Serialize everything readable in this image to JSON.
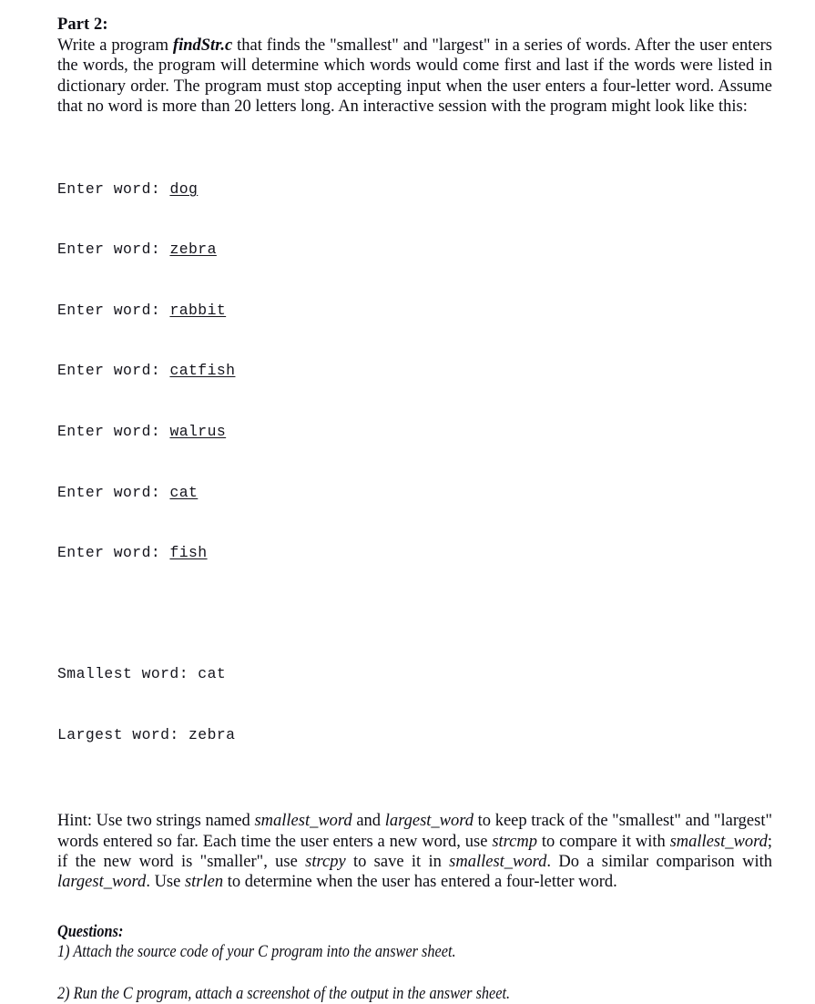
{
  "document": {
    "part_title": "Part 2:",
    "intro": {
      "before_program_name": "Write a program ",
      "program_name": "findStr.c",
      "after_program_name": " that finds the \"smallest\" and \"largest\" in a series of words. After the user enters the words, the program will determine which words would come first and last if the words were listed in dictionary order. The program must stop accepting input when the user enters a four-letter word. Assume that no word is more than 20 letters long. An interactive session with the program might look like this:"
    },
    "console": {
      "prompt": "Enter word: ",
      "entries": [
        "dog",
        "zebra",
        "rabbit",
        "catfish",
        "walrus",
        "cat",
        "fish"
      ],
      "result_lines": [
        {
          "label": "Smallest word: ",
          "value": "cat"
        },
        {
          "label": "Largest word: ",
          "value": "zebra"
        }
      ]
    },
    "hint": {
      "s1": "Hint: Use two strings named ",
      "i1": "smallest_word",
      "s2": " and ",
      "i2": "largest_word",
      "s3": " to keep track of the \"smallest\" and \"largest\" words entered so far. Each time the user enters a new word, use ",
      "i3": "strcmp",
      "s4": " to compare it with ",
      "i4": "smallest_word",
      "s5": "; if the new word is \"smaller\", use ",
      "i5": "strcpy",
      "s6": " to save it in ",
      "i6": "smallest_word",
      "s7": ". Do a similar comparison with ",
      "i7": "largest_word",
      "s8": ". Use ",
      "i8": "strlen",
      "s9": " to determine when the user has entered a four-letter word."
    },
    "questions": {
      "heading": "Questions:",
      "items": [
        "1) Attach the source code of your C program into the answer sheet.",
        "2) Run the C program, attach a screenshot of the output in the answer sheet."
      ]
    }
  }
}
